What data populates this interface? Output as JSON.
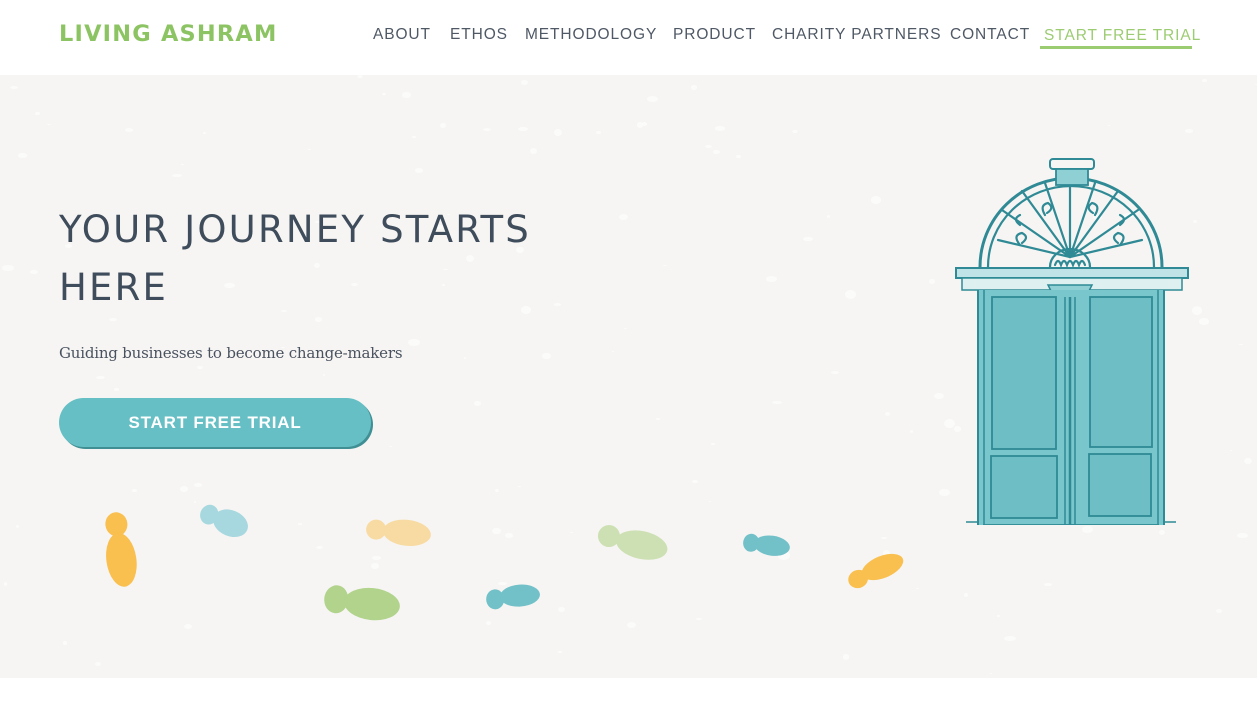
{
  "brand": {
    "logo_text": "LIVING ASHRAM",
    "logo_color": "#8dc463"
  },
  "nav": {
    "items": [
      {
        "label": "ABOUT"
      },
      {
        "label": "ETHOS"
      },
      {
        "label": "METHODOLOGY"
      },
      {
        "label": "PRODUCT"
      },
      {
        "label": "CHARITY PARTNERS"
      },
      {
        "label": "CONTACT"
      }
    ],
    "cta_label": "START FREE TRIAL",
    "cta_color": "#9ccc72"
  },
  "hero": {
    "title_line1": "YOUR JOURNEY STARTS",
    "title_line2": "HERE",
    "subtitle": "Guiding businesses to become change-makers",
    "button_label": "START FREE TRIAL",
    "button_color": "#66bfc4",
    "background_color": "#f6f5f3"
  },
  "illustration": {
    "door_icon": "door-illustration",
    "door_color": "#6ec3c8",
    "footprint_colors": [
      "#f9bf4f",
      "#a7d8df",
      "#f8dba3",
      "#b1d38c",
      "#72c0c8",
      "#cde0b3",
      "#72c0c8",
      "#f9bf4f"
    ]
  }
}
